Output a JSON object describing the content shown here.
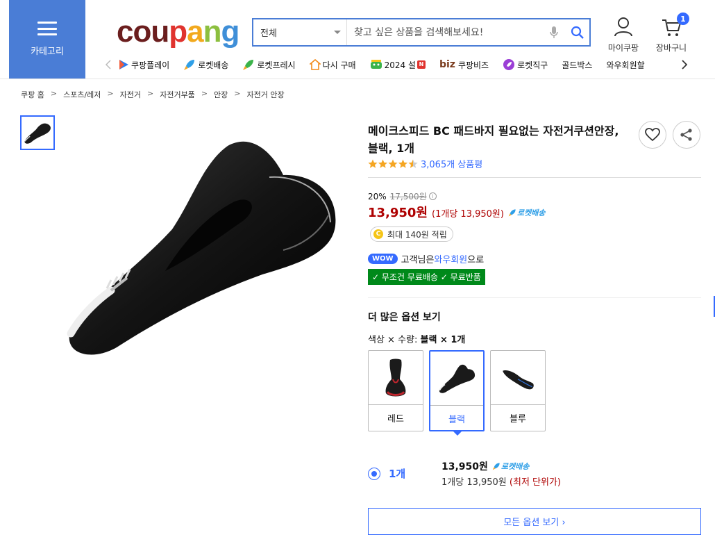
{
  "header": {
    "category_label": "카테고리",
    "logo_text": [
      "cou",
      "p",
      "a",
      "n",
      "g"
    ],
    "search": {
      "scope": "전체",
      "placeholder": "찾고 싶은 상품을 검색해보세요!"
    },
    "mycoupang_label": "마이쿠팡",
    "cart_label": "장바구니",
    "cart_count": "1"
  },
  "subnav": {
    "items": [
      {
        "label": "쿠팡플레이",
        "icon": "play-icon"
      },
      {
        "label": "로켓배송",
        "icon": "rocket-icon"
      },
      {
        "label": "로켓프레시",
        "icon": "rocket-fresh-icon"
      },
      {
        "label": "다시 구매",
        "icon": "rebuy-icon"
      },
      {
        "label": "2024 설",
        "icon": "dragon-icon",
        "badge": "N"
      },
      {
        "label": "쿠팡비즈",
        "icon": "biz-icon",
        "prefix": "biz"
      },
      {
        "label": "로켓직구",
        "icon": "global-rocket-icon"
      },
      {
        "label": "골드박스",
        "icon": ""
      },
      {
        "label": "와우회원할",
        "icon": ""
      }
    ]
  },
  "breadcrumb": [
    "쿠팡 홈",
    "스포츠/레저",
    "자전거",
    "자전거부품",
    "안장",
    "자전거 안장"
  ],
  "product": {
    "title": "메이크스피드 BC 패드바지 필요없는 자전거쿠션안장, 블랙, 1개",
    "rating": 4.5,
    "review_text": "3,065개 상품평",
    "discount_rate": "20%",
    "original_price": "17,500원",
    "price": "13,950원",
    "unit_price": "(1개당 13,950원)",
    "rocket_label": "로켓배송",
    "reward": "최대 140원 적립",
    "wow_badge": "WOW",
    "wow_text_pre": "고객님은 ",
    "wow_link": "와우회원",
    "wow_text_post": "으로",
    "free_label": "✓ 무조건 무료배송 ✓ 무료반품"
  },
  "options": {
    "title": "더 많은 옵션 보기",
    "subtitle_key": "색상 × 수량: ",
    "subtitle_val": "블랙 × 1개",
    "colors": [
      {
        "label": "레드",
        "selected": false
      },
      {
        "label": "블랙",
        "selected": true
      },
      {
        "label": "블루",
        "selected": false
      }
    ],
    "quantity": {
      "label": "1개",
      "price": "13,950원",
      "rocket_label": "로켓배송",
      "unit_text": "1개당 13,950원 ",
      "lowest_text": "(최저 단위가)"
    },
    "all_button": "모든 옵션 보기 ›"
  },
  "colors": {
    "brand_blue": "#346aff",
    "price_red": "#ae0000",
    "free_green": "#00891a",
    "category_bg": "#4a7dd6"
  }
}
